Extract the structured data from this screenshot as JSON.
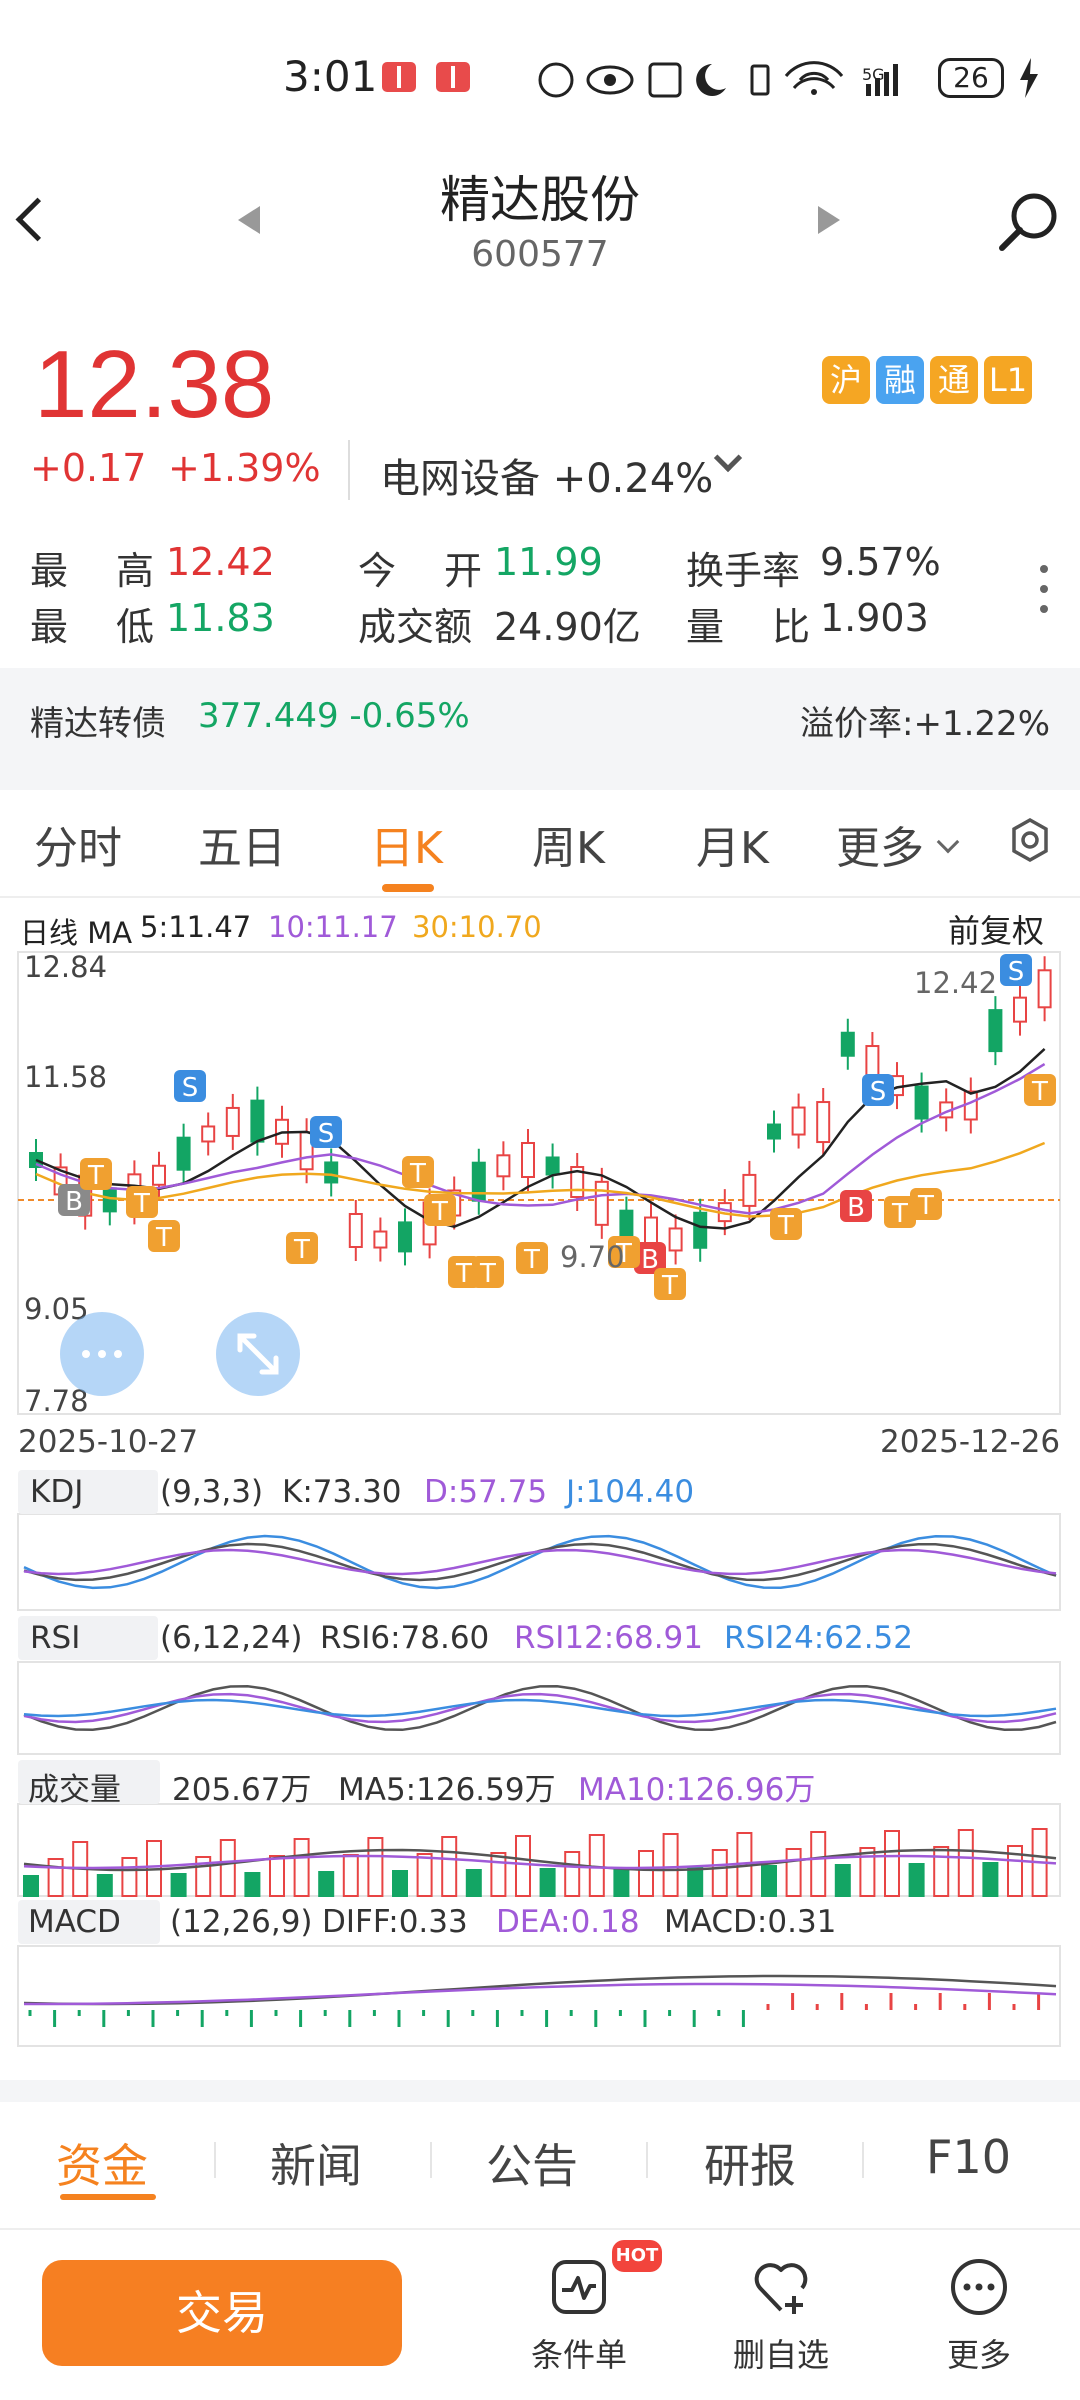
{
  "status_bar": {
    "time": "3:01",
    "signal": "5G",
    "battery": "26"
  },
  "header": {
    "stock_name": "精达股份",
    "stock_code": "600577"
  },
  "quote": {
    "price": "12.38",
    "change": "+0.17",
    "change_pct": "+1.39%",
    "sector": "电网设备 +0.24%",
    "tags": [
      {
        "label": "沪",
        "color": "#f5a623"
      },
      {
        "label": "融",
        "color": "#4aa3f0"
      },
      {
        "label": "通",
        "color": "#f5a623"
      },
      {
        "label": "L1",
        "color": "#f5a623"
      }
    ],
    "high_label_a": "最",
    "high_label_b": "高",
    "high_value": "12.42",
    "low_label_a": "最",
    "low_label_b": "低",
    "low_value": "11.83",
    "open_label_a": "今",
    "open_label_b": "开",
    "open_value": "11.99",
    "amount_label": "成交额",
    "amount_value": "24.90亿",
    "turnover_label": "换手率",
    "turnover_value": "9.57%",
    "ratio_label_a": "量",
    "ratio_label_b": "比",
    "ratio_value": "1.903"
  },
  "bond": {
    "name": "精达转债",
    "value": "377.449 -0.65%",
    "premium": "溢价率:+1.22%"
  },
  "tabs": {
    "items": [
      "分时",
      "五日",
      "日K",
      "周K",
      "月K",
      "更多"
    ],
    "active_index": 2
  },
  "kline": {
    "header_label": "日线 MA",
    "ma5": "5:11.47",
    "ma10": "10:11.17",
    "ma30": "30:10.70",
    "adjust": "前复权",
    "y_top": "12.84",
    "y_mid": "11.58",
    "y_low": "9.05",
    "y_bottom": "7.78",
    "max_label": "12.42",
    "min_label": "9.70",
    "date_start": "2025-10-27",
    "date_end": "2025-12-26",
    "colors": {
      "up": "#e84444",
      "down": "#13a564",
      "ma5": "#222222",
      "ma10": "#a05ad8",
      "ma30": "#f0a81e"
    }
  },
  "kdj": {
    "name": "KDJ",
    "params": "(9,3,3)",
    "k": "K:73.30",
    "d": "D:57.75",
    "j": "J:104.40"
  },
  "rsi": {
    "name": "RSI",
    "params": "(6,12,24)",
    "rsi6": "RSI6:78.60",
    "rsi12": "RSI12:68.91",
    "rsi24": "RSI24:62.52"
  },
  "volume": {
    "name": "成交量",
    "value": "205.67万",
    "ma5": "MA5:126.59万",
    "ma10": "MA10:126.96万"
  },
  "macd": {
    "name": "MACD",
    "params": "(12,26,9)",
    "diff": "DIFF:0.33",
    "dea": "DEA:0.18",
    "macd": "MACD:0.31"
  },
  "signals": {
    "buy": "B",
    "sell": "S",
    "t": "T"
  },
  "bottom_tabs": [
    "资金",
    "新闻",
    "公告",
    "研报",
    "F10"
  ],
  "footer": {
    "trade": "交易",
    "condition": "条件单",
    "hot": "HOT",
    "watchlist": "删自选",
    "more": "更多"
  }
}
